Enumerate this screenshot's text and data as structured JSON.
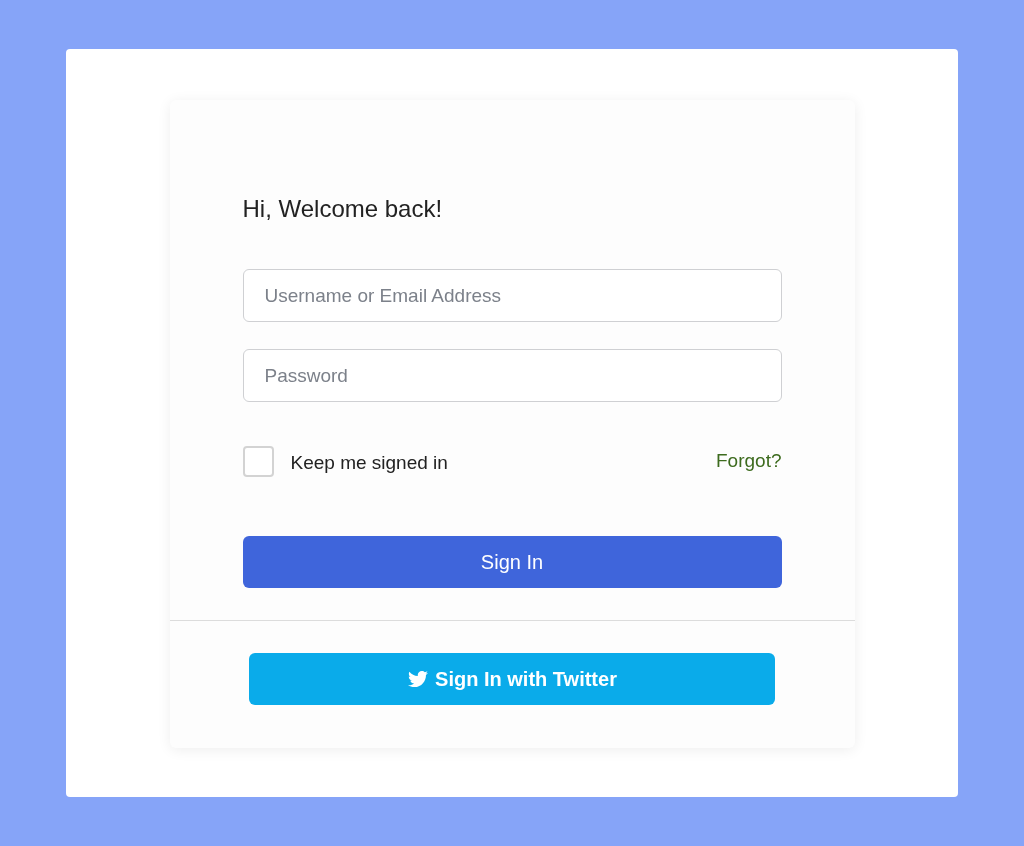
{
  "greeting": "Hi, Welcome back!",
  "fields": [
    {
      "placeholder": "Username or Email Address"
    },
    {
      "placeholder": "Password"
    }
  ],
  "remember": {
    "label": "Keep me signed in",
    "checked": false
  },
  "forgot_link": "Forgot?",
  "sign_in_button": "Sign In",
  "twitter_button": "Sign In with Twitter"
}
